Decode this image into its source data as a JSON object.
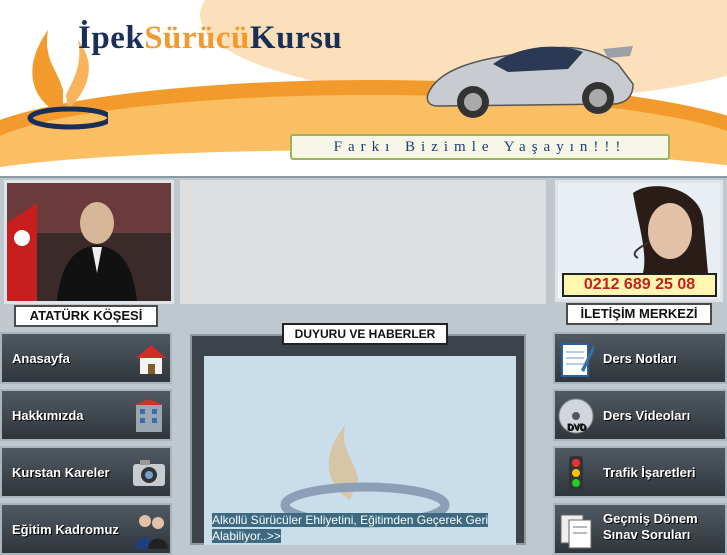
{
  "header": {
    "brand_prefix": "İpek",
    "brand_middle": "Sürücü",
    "brand_suffix": "Kursu",
    "slogan": "Farkı Bizimle Yaşayın!!!"
  },
  "left_panel": {
    "label": "ATATÜRK KÖŞESİ"
  },
  "right_panel": {
    "phone": "0212 689 25 08",
    "label": "İLETİŞİM MERKEZİ"
  },
  "left_menu": [
    {
      "label": "Anasayfa",
      "icon": "house-icon"
    },
    {
      "label": "Hakkımızda",
      "icon": "building-icon"
    },
    {
      "label": "Kurstan Kareler",
      "icon": "camera-icon"
    },
    {
      "label": "Eğitim Kadromuz",
      "icon": "people-icon"
    }
  ],
  "right_menu": [
    {
      "label": "Ders Notları",
      "icon": "notepad-icon"
    },
    {
      "label": "Ders Videoları",
      "icon": "dvd-icon"
    },
    {
      "label": "Trafik İşaretleri",
      "icon": "traffic-light-icon"
    },
    {
      "label_line1": "Geçmiş Dönem",
      "label_line2": "Sınav Soruları",
      "icon": "documents-icon"
    }
  ],
  "news": {
    "title": "DUYURU VE HABERLER",
    "item_text": "Alkollü Sürücüler Ehliyetini, Eğitimden Geçerek Geri Alabiliyor..>>"
  },
  "colors": {
    "accent": "#f39a2c",
    "brand": "#1a2f57",
    "panel_dark": "#2f363c"
  }
}
